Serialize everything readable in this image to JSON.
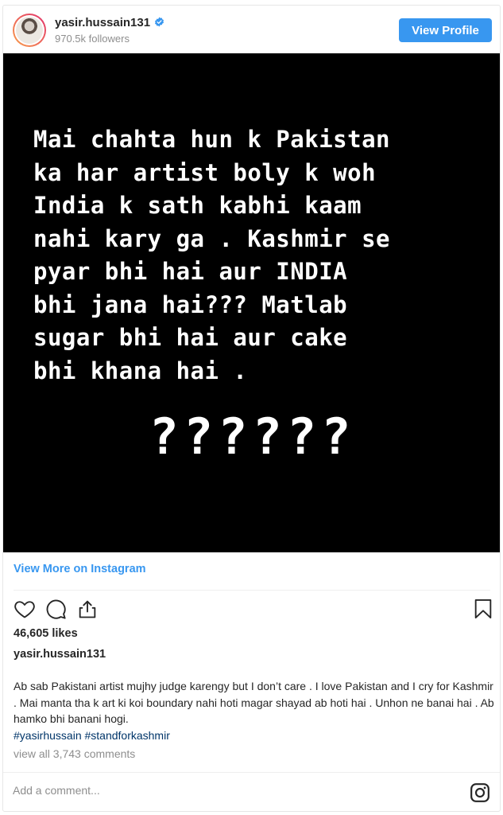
{
  "header": {
    "username": "yasir.hussain131",
    "followers": "970.5k followers",
    "view_profile_label": "View Profile",
    "verified_color": "#3897f0"
  },
  "post_image": {
    "lines": [
      "Mai chahta hun k Pakistan",
      "ka har artist boly k woh",
      "India k sath kabhi kaam",
      "nahi kary ga . Kashmir se",
      "pyar bhi hai aur INDIA",
      "bhi jana hai??? Matlab",
      "sugar bhi hai aur cake",
      "bhi khana hai ."
    ],
    "question_marks": "??????"
  },
  "view_more_label": "View More on Instagram",
  "actions": {
    "icons": [
      "heart-icon",
      "comment-icon",
      "share-icon",
      "bookmark-icon"
    ]
  },
  "likes": "46,605 likes",
  "caption": {
    "username": "yasir.hussain131",
    "text": "Ab sab Pakistani artist mujhy judge karengy but I don’t care . I love Pakistan and I cry for Kashmir . Mai manta tha k art ki koi boundary nahi hoti magar shayad ab hoti hai . Unhon ne banai hai . Ab hamko bhi banani hogi.",
    "hashtags": "#yasirhussain #standforkashmir"
  },
  "view_all_comments": "view all 3,743 comments",
  "add_comment_placeholder": "Add a comment...",
  "colors": {
    "accent": "#3897f0",
    "hashtag": "#003569",
    "muted": "#8e8e8e"
  }
}
